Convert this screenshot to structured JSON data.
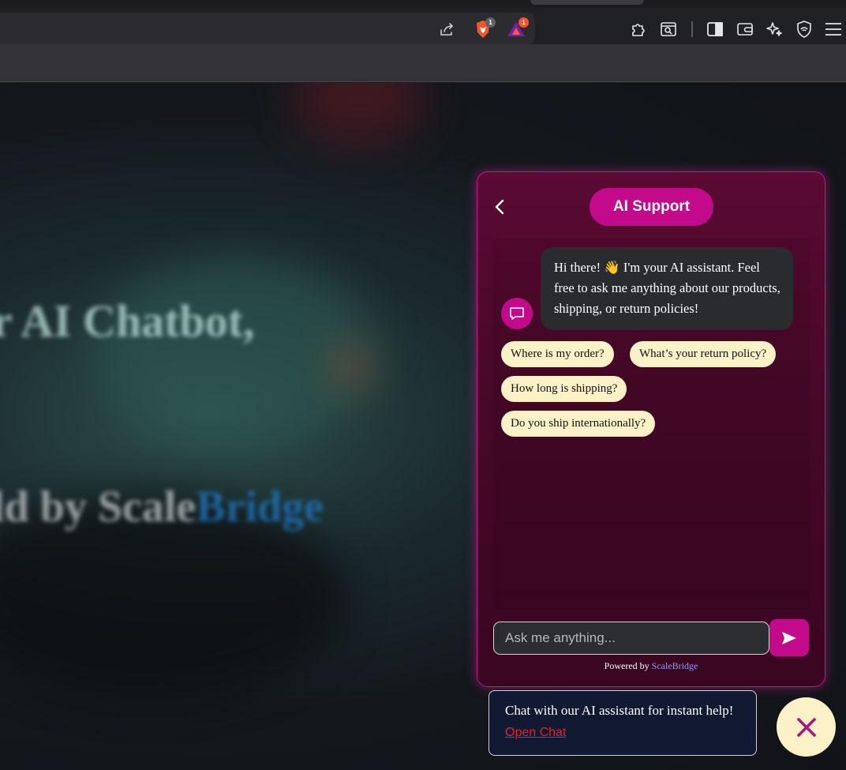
{
  "browser": {
    "toolbar_icons": [
      "share-icon",
      "brave-shields-icon",
      "brave-rewards-icon",
      "extensions-icon",
      "reader-mode-icon",
      "sidebar-icon",
      "wallet-icon",
      "leo-ai-icon",
      "vpn-icon",
      "menu-icon"
    ],
    "shields_badge": "1",
    "rewards_badge": "1",
    "colors": {
      "chrome": "#202124",
      "shields": "#fb542b",
      "badge": "#5f6368"
    }
  },
  "background_page": {
    "headline_fragment": "r AI Chatbot,",
    "sub_fragment": "ld by Scale",
    "brand_fragment": "Bridge"
  },
  "chat": {
    "title": "AI Support",
    "back_icon": "chevron-left-icon",
    "avatar_icon": "chat-bubble-icon",
    "greeting": "Hi there! 👋 I'm your AI assistant. Feel free to ask me anything about our products, shipping, or return policies!",
    "quick_replies": [
      "Where is my order?",
      "What’s your return policy?",
      "How long is shipping?",
      "Do you ship internationally?"
    ],
    "input_placeholder": "Ask me anything...",
    "send_icon": "send-icon",
    "powered_by_label": "Powered by",
    "powered_by_brand": "ScaleBridge",
    "colors": {
      "accent": "#c20a8a",
      "chip": "#fdf1c8",
      "panel": "#470828",
      "bubble": "#2a2b2f"
    }
  },
  "toast": {
    "message": "Chat with our AI assistant for instant help!",
    "link": "Open Chat",
    "close_icon": "close-icon"
  }
}
